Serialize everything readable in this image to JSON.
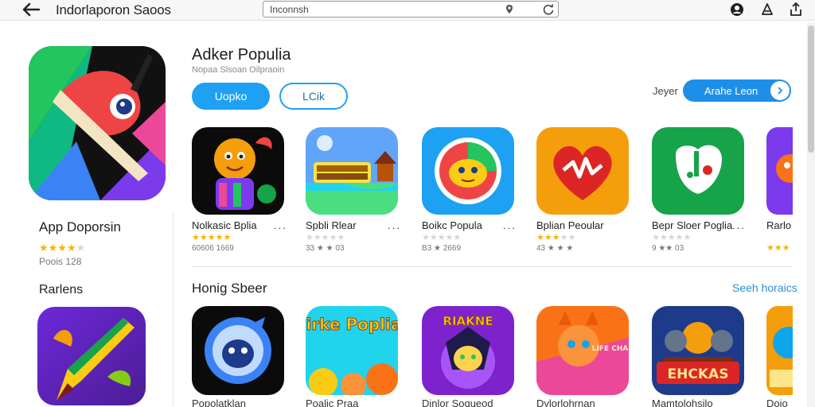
{
  "topbar": {
    "title": "Indorlaporon Saoos",
    "url": "Inconnsh",
    "icons": [
      "back-arrow-icon",
      "pin-icon",
      "reload-icon",
      "account-icon",
      "bell-icon",
      "share-icon"
    ]
  },
  "app": {
    "name": "App Doporsin",
    "rating_stars": 4,
    "count": "Poois 128"
  },
  "sidebar": {
    "section_title": "Rarlens"
  },
  "main": {
    "title": "Adker Populia",
    "subtitle": "Nopaa Slsoan Oilpraoin",
    "primary_button": "Uopko",
    "secondary_button": "LCik",
    "filter_label": "Jeyer",
    "filter_value": "Arahe Leon"
  },
  "row1": [
    {
      "name": "Nolkasic Bplia",
      "stars": 5,
      "meta": "60606 1669"
    },
    {
      "name": "Spbli Rlear",
      "stars": 0,
      "meta": "33 ★ ★ 03"
    },
    {
      "name": "Boikc Popula",
      "stars": 0,
      "meta": "B3 ★ 2669"
    },
    {
      "name": "Bplian Peoular",
      "stars": 3,
      "meta": "43 ★ ★ ★"
    },
    {
      "name": "Bepr Sloer Poglia",
      "stars": 0,
      "meta": "9 ★★ 03"
    },
    {
      "name": "Rarlo",
      "stars": 3,
      "meta": ""
    }
  ],
  "section2": {
    "title": "Honig Sbeer",
    "see_more": "Seeh horaics"
  },
  "row2": [
    {
      "name": "Popolatklan"
    },
    {
      "name": "Poalic Praa",
      "banner": "Hirke Poplias"
    },
    {
      "name": "Dinlor Soqueod",
      "banner": "RIAKNE"
    },
    {
      "name": "Dylorlohrnan",
      "banner": "LIFE CHAR"
    },
    {
      "name": "Mamtolohsilo",
      "banner": "EHCKAS"
    },
    {
      "name": "Doio"
    }
  ],
  "colors": {
    "accent": "#1ea0f3",
    "star": "#f5b400",
    "link": "#2a8fd8"
  }
}
